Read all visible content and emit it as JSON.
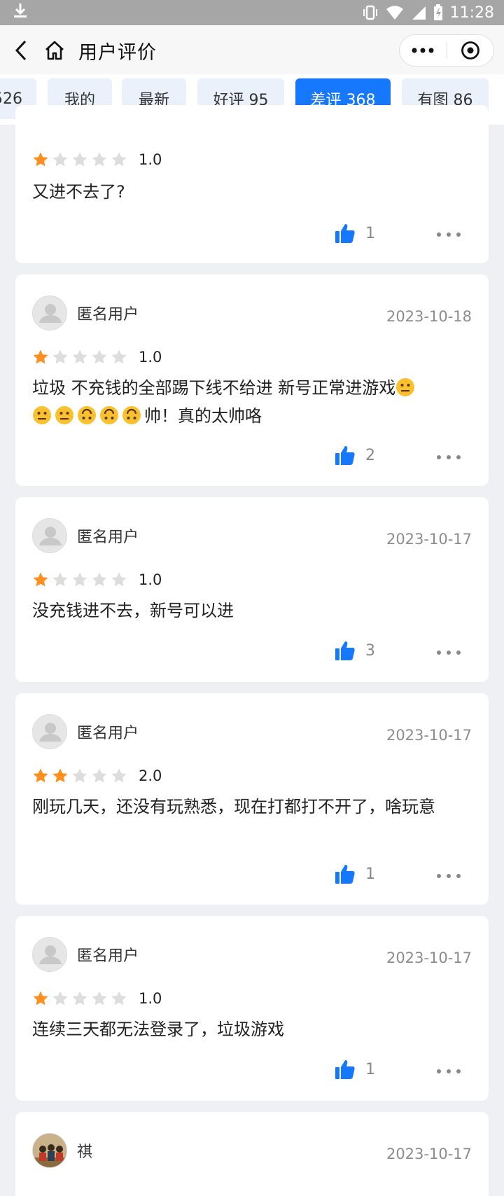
{
  "status_bar": {
    "time": "11:28"
  },
  "nav": {
    "title": "用户评价"
  },
  "tabs": [
    {
      "label": "526",
      "active": false
    },
    {
      "label": "我的",
      "active": false
    },
    {
      "label": "最新",
      "active": false
    },
    {
      "label": "好评 95",
      "active": false
    },
    {
      "label": "差评 368",
      "active": true
    },
    {
      "label": "有图 86",
      "active": false
    }
  ],
  "colors": {
    "accent": "#1677ff",
    "star": "#ff8f1f",
    "star_empty": "#dddddd"
  },
  "reviews": [
    {
      "user": "",
      "date": "",
      "rating": 1,
      "score": "1.0",
      "text": "又进不去了?",
      "likes": "1",
      "partial": true
    },
    {
      "user": "匿名用户",
      "date": "2023-10-18",
      "rating": 1,
      "score": "1.0",
      "text_a": "垃圾 不充钱的全部踢下线不给进 新号正常进游戏",
      "text_b": "帅！真的太帅咯",
      "likes": "2"
    },
    {
      "user": "匿名用户",
      "date": "2023-10-17",
      "rating": 1,
      "score": "1.0",
      "text": "没充钱进不去，新号可以进",
      "likes": "3"
    },
    {
      "user": "匿名用户",
      "date": "2023-10-17",
      "rating": 2,
      "score": "2.0",
      "text": "刚玩几天，还没有玩熟悉，现在打都打不开了，啥玩意",
      "likes": "1"
    },
    {
      "user": "匿名用户",
      "date": "2023-10-17",
      "rating": 1,
      "score": "1.0",
      "text": "连续三天都无法登录了，垃圾游戏",
      "likes": "1"
    },
    {
      "user": "祺",
      "date": "2023-10-17"
    }
  ]
}
